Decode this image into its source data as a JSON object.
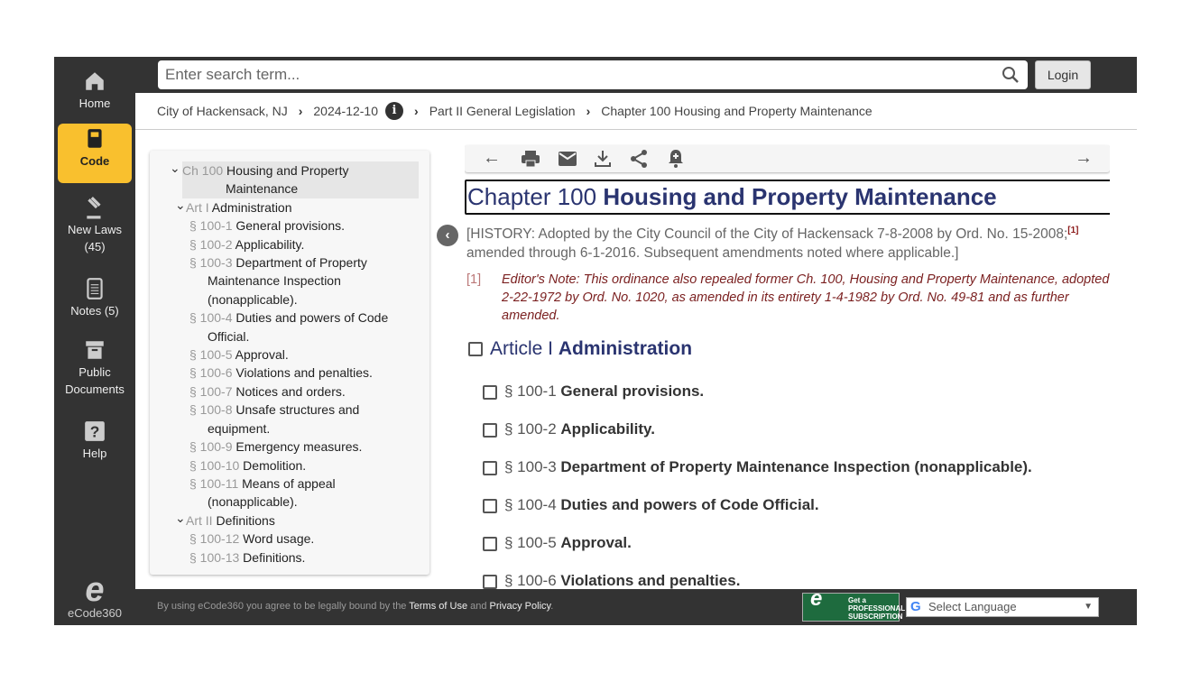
{
  "sidebar": {
    "items": [
      {
        "label": "Home"
      },
      {
        "label": "Code"
      },
      {
        "label": "New Laws",
        "count": "(45)"
      },
      {
        "label": "Notes (5)"
      },
      {
        "label": "Public Documents"
      },
      {
        "label": "Help"
      }
    ],
    "logo": "eCode360"
  },
  "search": {
    "placeholder": "Enter search term...",
    "login": "Login"
  },
  "breadcrumb": [
    "City of Hackensack, NJ",
    "2024-12-10",
    "Part II General Legislation",
    "Chapter 100 Housing and Property Maintenance"
  ],
  "toc": [
    {
      "num": "Ch 100",
      "title": "Housing and Property Maintenance"
    },
    {
      "num": "Art I",
      "title": "Administration"
    },
    {
      "num": "§ 100-1",
      "title": "General provisions."
    },
    {
      "num": "§ 100-2",
      "title": "Applicability."
    },
    {
      "num": "§ 100-3",
      "title": "Department of Property Maintenance Inspection (nonapplicable)."
    },
    {
      "num": "§ 100-4",
      "title": "Duties and powers of Code Official."
    },
    {
      "num": "§ 100-5",
      "title": "Approval."
    },
    {
      "num": "§ 100-6",
      "title": "Violations and penalties."
    },
    {
      "num": "§ 100-7",
      "title": "Notices and orders."
    },
    {
      "num": "§ 100-8",
      "title": "Unsafe structures and equipment."
    },
    {
      "num": "§ 100-9",
      "title": "Emergency measures."
    },
    {
      "num": "§ 100-10",
      "title": "Demolition."
    },
    {
      "num": "§ 100-11",
      "title": "Means of appeal (nonapplicable)."
    },
    {
      "num": "Art II",
      "title": "Definitions"
    },
    {
      "num": "§ 100-12",
      "title": "Word usage."
    },
    {
      "num": "§ 100-13",
      "title": "Definitions."
    }
  ],
  "main": {
    "title_num": "Chapter 100",
    "title": "Housing and Property Maintenance",
    "history": "[HISTORY: Adopted by the City Council of the City of Hackensack 7-8-2008 by Ord. No. 15-2008;",
    "history_sup": "[1]",
    "history2": "amended through 6-1-2016. Subsequent amendments noted where applicable.]",
    "note_num": "[1]",
    "note": "Editor's Note: This ordinance also repealed former Ch. 100, Housing and Property Maintenance, adopted 2-22-1972 by Ord. No. 1020, as amended in its entirety 1-4-1982 by Ord. No. 49-81 and as further amended.",
    "article_num": "Article I",
    "article": "Administration",
    "sections": [
      {
        "num": "§ 100-1",
        "title": "General provisions."
      },
      {
        "num": "§ 100-2",
        "title": "Applicability."
      },
      {
        "num": "§ 100-3",
        "title": "Department of Property Maintenance Inspection (nonapplicable)."
      },
      {
        "num": "§ 100-4",
        "title": "Duties and powers of Code Official."
      },
      {
        "num": "§ 100-5",
        "title": "Approval."
      },
      {
        "num": "§ 100-6",
        "title": "Violations and penalties."
      }
    ]
  },
  "footer": {
    "pre": "By using eCode360 you agree to be legally bound by the ",
    "terms": "Terms of Use",
    "and": " and ",
    "privacy": "Privacy Policy",
    "post": ".",
    "pro1": "Get a",
    "pro2": "PROFESSIONAL",
    "pro3": "SUBSCRIPTION",
    "language": "Select Language"
  }
}
